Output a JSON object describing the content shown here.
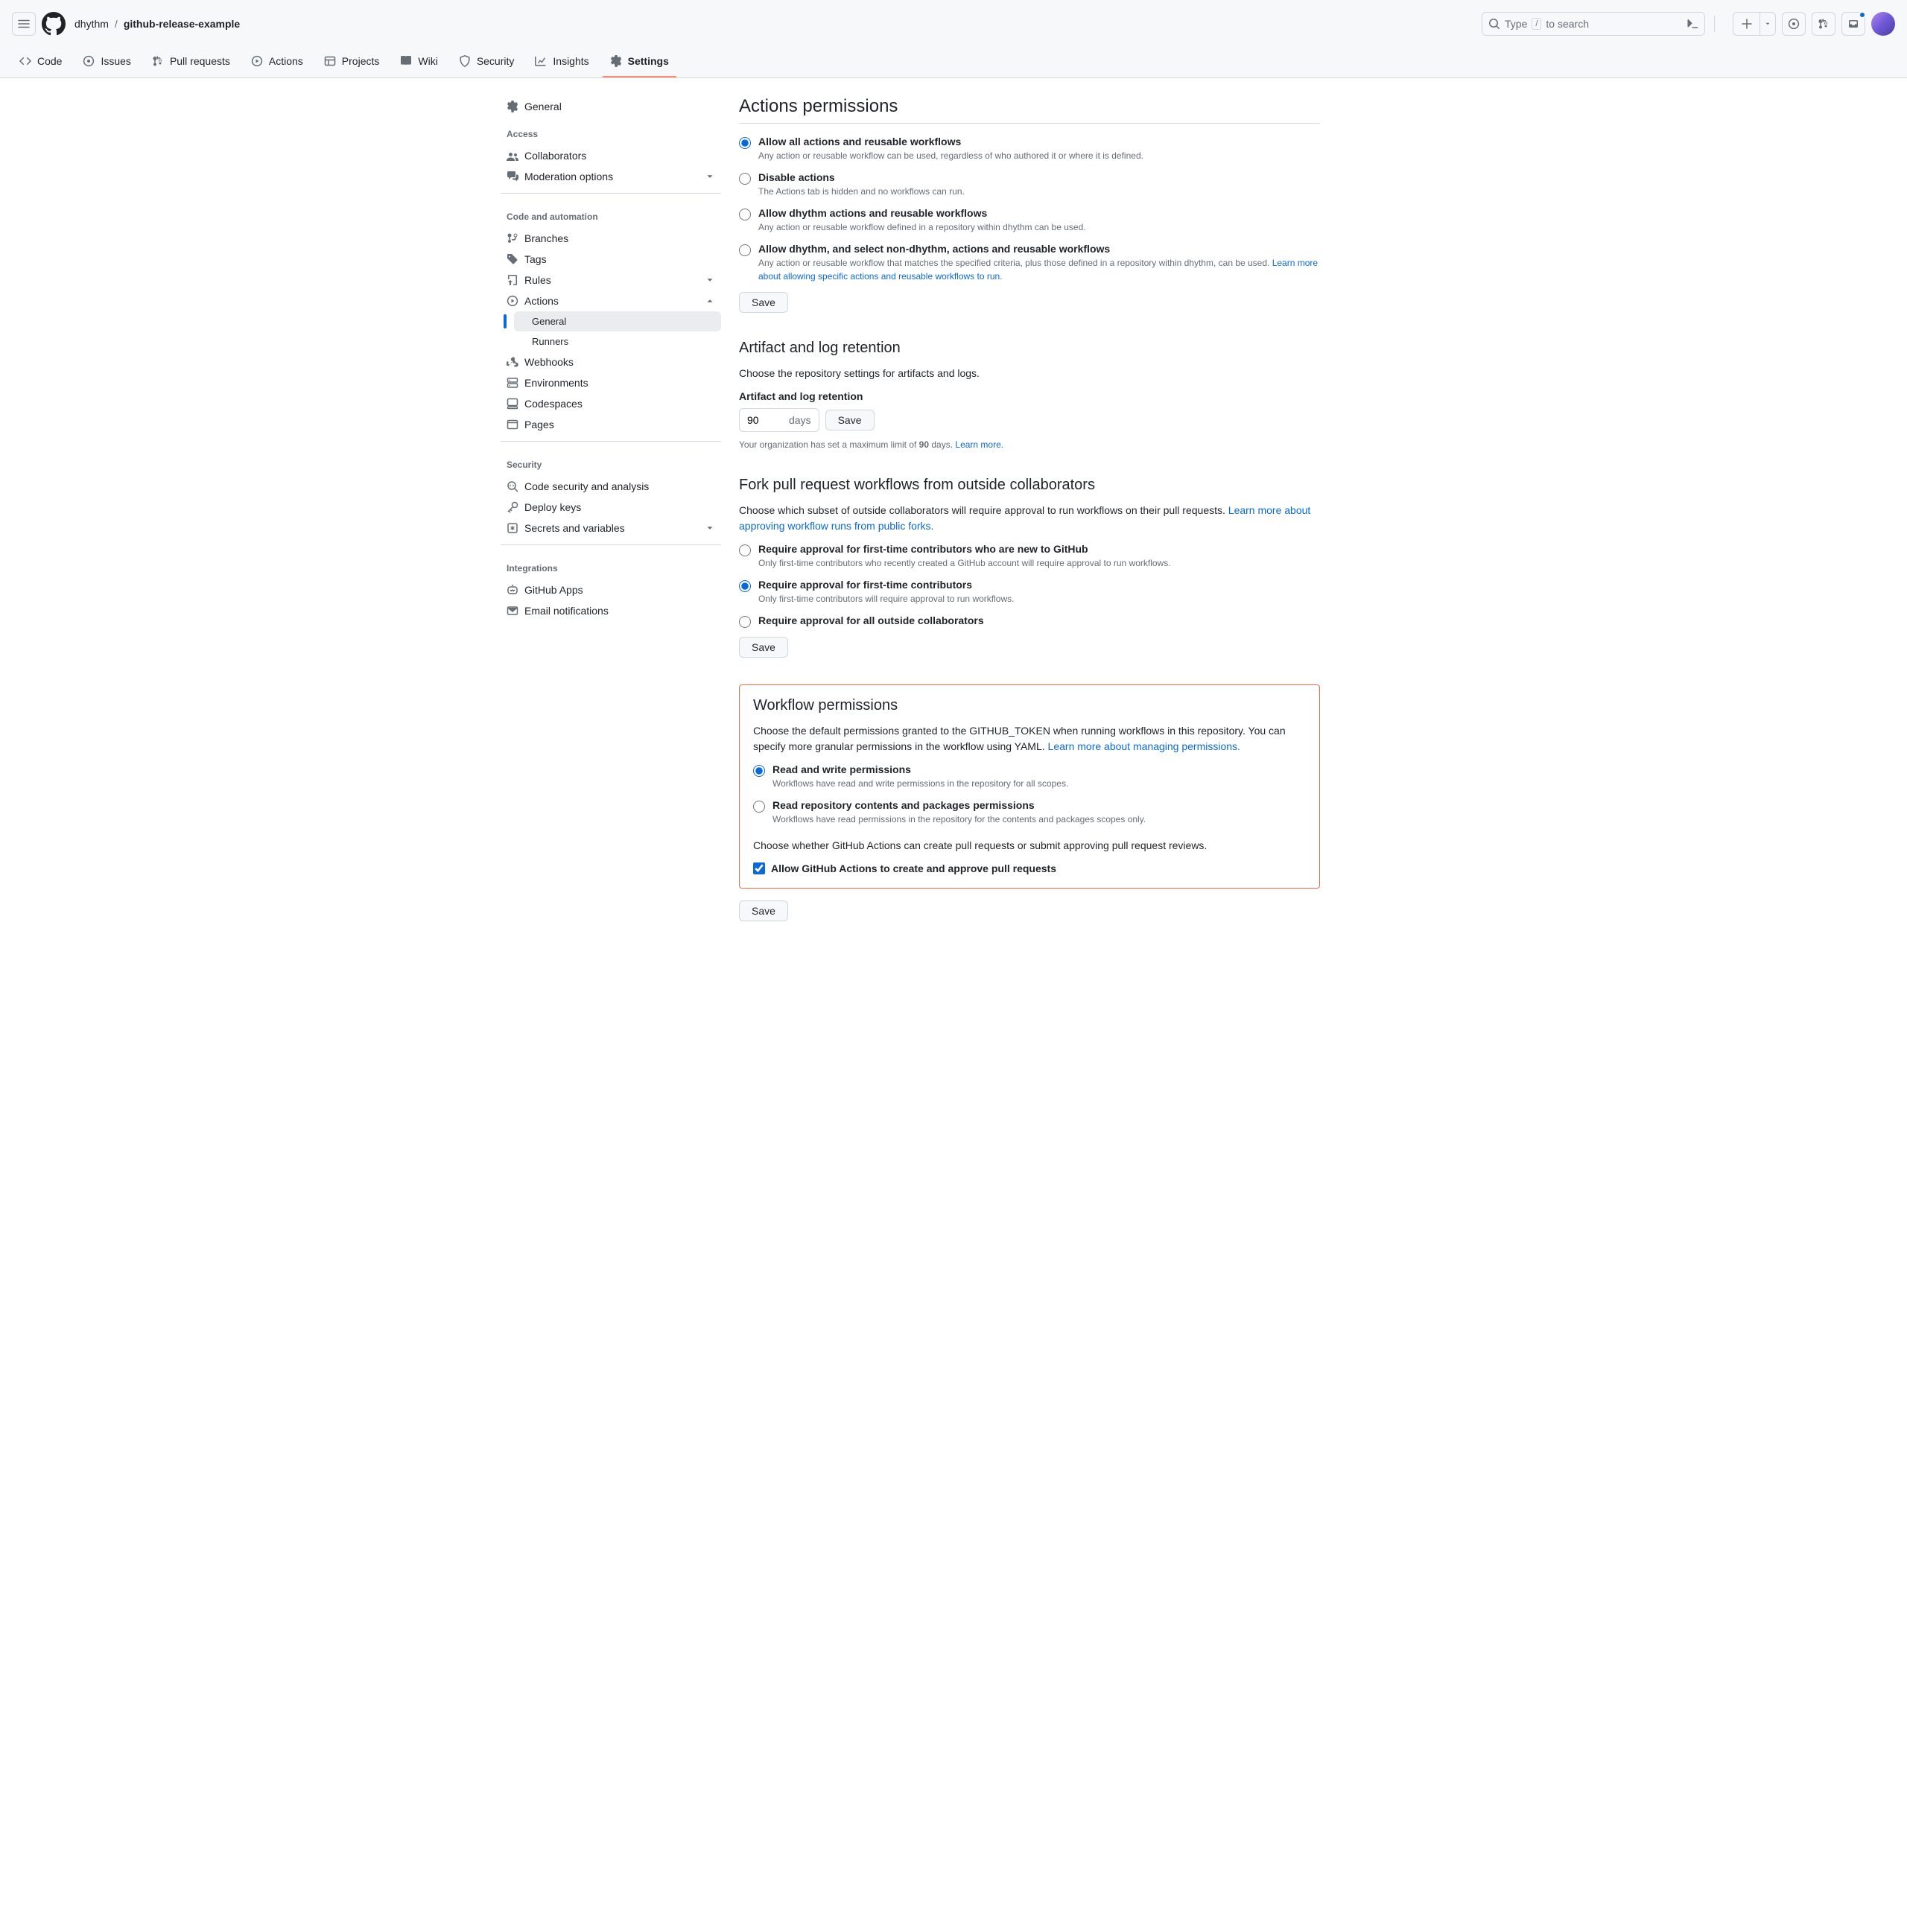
{
  "header": {
    "owner": "dhythm",
    "repo": "github-release-example",
    "search_prefix": "Type",
    "search_key": "/",
    "search_suffix": "to search"
  },
  "repo_nav": {
    "code": "Code",
    "issues": "Issues",
    "pull_requests": "Pull requests",
    "actions": "Actions",
    "projects": "Projects",
    "wiki": "Wiki",
    "security": "Security",
    "insights": "Insights",
    "settings": "Settings"
  },
  "sidebar": {
    "general": "General",
    "access_title": "Access",
    "collaborators": "Collaborators",
    "moderation": "Moderation options",
    "automation_title": "Code and automation",
    "branches": "Branches",
    "tags": "Tags",
    "rules": "Rules",
    "actions": "Actions",
    "actions_general": "General",
    "actions_runners": "Runners",
    "webhooks": "Webhooks",
    "environments": "Environments",
    "codespaces": "Codespaces",
    "pages": "Pages",
    "security_title": "Security",
    "code_security": "Code security and analysis",
    "deploy_keys": "Deploy keys",
    "secrets": "Secrets and variables",
    "integrations_title": "Integrations",
    "github_apps": "GitHub Apps",
    "email_notifications": "Email notifications"
  },
  "actions_permissions": {
    "title": "Actions permissions",
    "opt1_label": "Allow all actions and reusable workflows",
    "opt1_desc": "Any action or reusable workflow can be used, regardless of who authored it or where it is defined.",
    "opt2_label": "Disable actions",
    "opt2_desc": "The Actions tab is hidden and no workflows can run.",
    "opt3_label": "Allow dhythm actions and reusable workflows",
    "opt3_desc": "Any action or reusable workflow defined in a repository within dhythm can be used.",
    "opt4_label": "Allow dhythm, and select non-dhythm, actions and reusable workflows",
    "opt4_desc": "Any action or reusable workflow that matches the specified criteria, plus those defined in a repository within dhythm, can be used. ",
    "opt4_link": "Learn more about allowing specific actions and reusable workflows to run.",
    "save": "Save"
  },
  "retention": {
    "title": "Artifact and log retention",
    "desc": "Choose the repository settings for artifacts and logs.",
    "field_label": "Artifact and log retention",
    "value": "90",
    "unit": "days",
    "save": "Save",
    "note_prefix": "Your organization has set a maximum limit of ",
    "note_value": "90",
    "note_suffix": " days. ",
    "note_link": "Learn more."
  },
  "fork": {
    "title": "Fork pull request workflows from outside collaborators",
    "desc": "Choose which subset of outside collaborators will require approval to run workflows on their pull requests. ",
    "desc_link": "Learn more about approving workflow runs from public forks.",
    "opt1_label": "Require approval for first-time contributors who are new to GitHub",
    "opt1_desc": "Only first-time contributors who recently created a GitHub account will require approval to run workflows.",
    "opt2_label": "Require approval for first-time contributors",
    "opt2_desc": "Only first-time contributors will require approval to run workflows.",
    "opt3_label": "Require approval for all outside collaborators",
    "save": "Save"
  },
  "workflow": {
    "title": "Workflow permissions",
    "desc": "Choose the default permissions granted to the GITHUB_TOKEN when running workflows in this repository. You can specify more granular permissions in the workflow using YAML. ",
    "desc_link": "Learn more about managing permissions.",
    "opt1_label": "Read and write permissions",
    "opt1_desc": "Workflows have read and write permissions in the repository for all scopes.",
    "opt2_label": "Read repository contents and packages permissions",
    "opt2_desc": "Workflows have read permissions in the repository for the contents and packages scopes only.",
    "choose2": "Choose whether GitHub Actions can create pull requests or submit approving pull request reviews.",
    "check_label": "Allow GitHub Actions to create and approve pull requests",
    "save": "Save"
  }
}
